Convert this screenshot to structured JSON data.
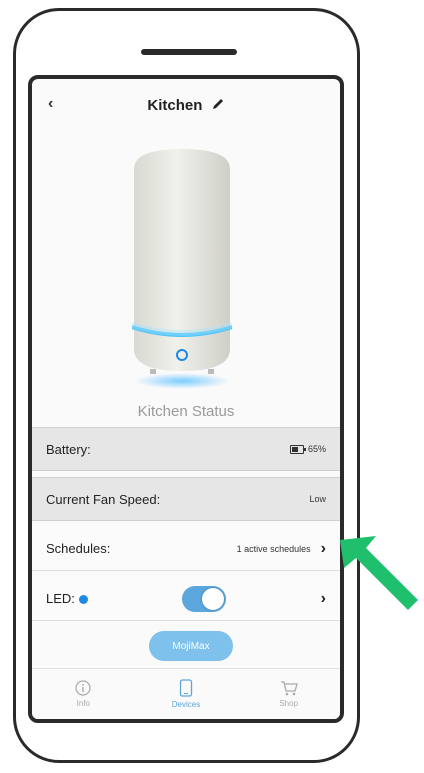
{
  "header": {
    "back_label": "‹",
    "title": "Kitchen"
  },
  "status_title": "Kitchen Status",
  "rows": {
    "battery": {
      "label": "Battery:",
      "value": "65%"
    },
    "fan_speed": {
      "label": "Current Fan Speed:",
      "value": "Low"
    },
    "schedules": {
      "label": "Schedules:",
      "value": "1 active schedules",
      "chevron": "›"
    },
    "led": {
      "label": "LED:",
      "toggle_on": true,
      "chevron": "›"
    }
  },
  "action_button": {
    "label": "MojiMax"
  },
  "tabbar": [
    {
      "label": "Info",
      "icon": "info-icon",
      "active": false
    },
    {
      "label": "Devices",
      "icon": "phone-icon",
      "active": true
    },
    {
      "label": "Shop",
      "icon": "cart-icon",
      "active": false
    }
  ],
  "colors": {
    "accent": "#5aa6dd",
    "led_dot": "#1e88e5",
    "arrow": "#1fbf6e",
    "button": "#7ec1ec"
  },
  "annotation": {
    "icon": "green-arrow-icon"
  }
}
